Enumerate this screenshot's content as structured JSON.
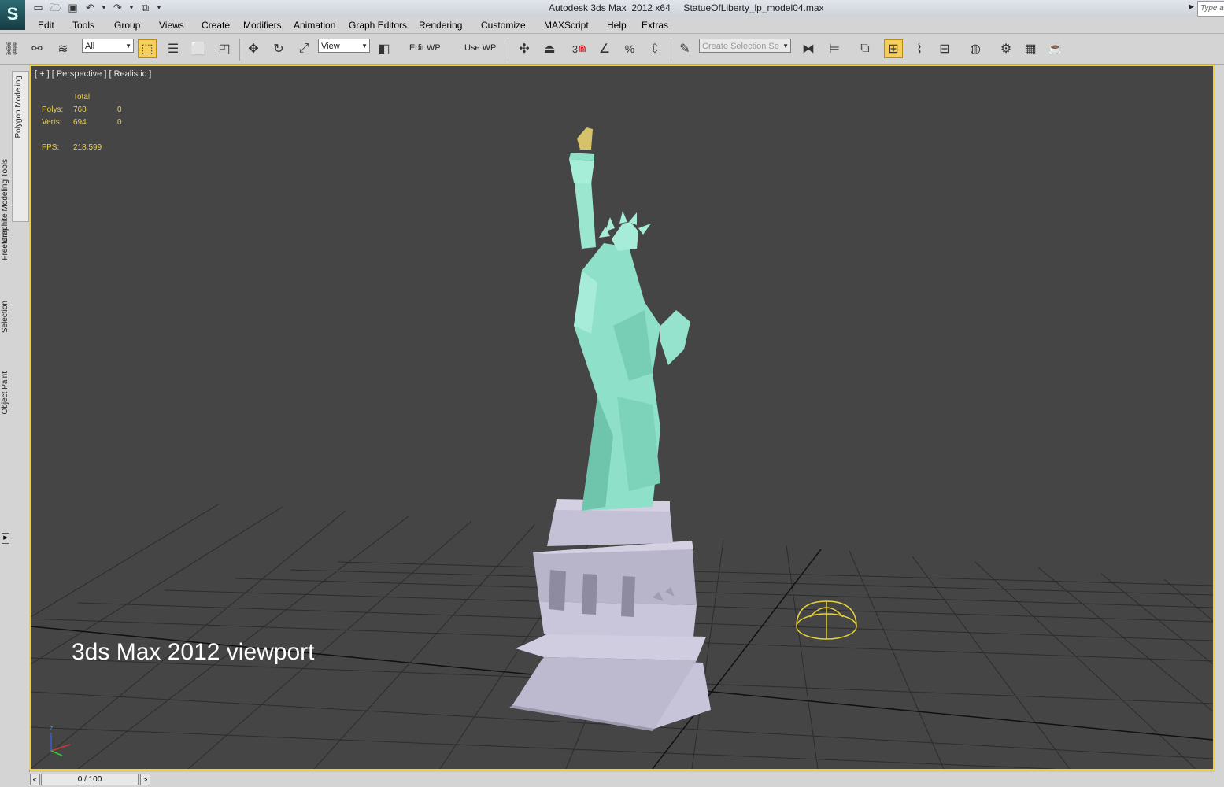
{
  "app": {
    "logo": "3ds-max-logo",
    "window_title": "Autodesk 3ds Max  2012 x64     StatueOfLiberty_lp_model04.max",
    "search_placeholder": "Type a"
  },
  "quick_access": [
    "new-file-icon",
    "open-file-icon",
    "save-icon",
    "undo-icon",
    "redo-icon",
    "project-folder-icon"
  ],
  "menu": [
    "Edit",
    "Tools",
    "Group",
    "Views",
    "Create",
    "Modifiers",
    "Animation",
    "Graph Editors",
    "Rendering",
    "Customize",
    "MAXScript",
    "Help",
    "Extras"
  ],
  "toolbar": {
    "filter_value": "All",
    "ref_coord_value": "View",
    "edit_wp_label": "Edit WP",
    "use_wp_label": "Use WP",
    "snap_label": "3",
    "selection_set_placeholder": "Create Selection Se",
    "icons": [
      "link-icon",
      "unlink-icon",
      "bind-spacewarp-icon",
      "select-object-icon",
      "select-by-name-icon",
      "rectangle-selection-icon",
      "window-crossing-icon",
      "move-icon",
      "rotate-icon",
      "scale-icon",
      "pivot-icon",
      "manipulate-icon",
      "snap-toggle-icon",
      "angle-snap-icon",
      "percent-snap-icon",
      "spinner-snap-icon",
      "named-selection-edit-icon",
      "mirror-icon",
      "align-icon",
      "layer-manager-icon",
      "graphite-toggle-icon",
      "curve-editor-icon",
      "schematic-view-icon",
      "material-editor-icon",
      "render-setup-icon",
      "rendered-frame-window-icon",
      "render-icon"
    ]
  },
  "left_panel": {
    "tabs": [
      "Graphite Modeling Tools",
      "Polygon Modeling",
      "Freeform",
      "Selection",
      "Object Paint"
    ]
  },
  "viewport": {
    "label": "[ + ] [ Perspective ] [ Realistic ]",
    "stats": {
      "header": "Total",
      "polys_label": "Polys:",
      "polys_total": "768",
      "polys_sel": "0",
      "verts_label": "Verts:",
      "verts_total": "694",
      "verts_sel": "0",
      "fps_label": "FPS:",
      "fps_value": "218.599"
    },
    "caption": "3ds Max 2012 viewport",
    "axis_label": "z",
    "colors": {
      "border": "#f2d233",
      "background": "#454545",
      "statue": "#8fe0c8",
      "pedestal": "#c4c0d6",
      "torch": "#d6c26a"
    }
  },
  "timeline": {
    "prev": "<",
    "position": "0 / 100",
    "next": ">"
  }
}
